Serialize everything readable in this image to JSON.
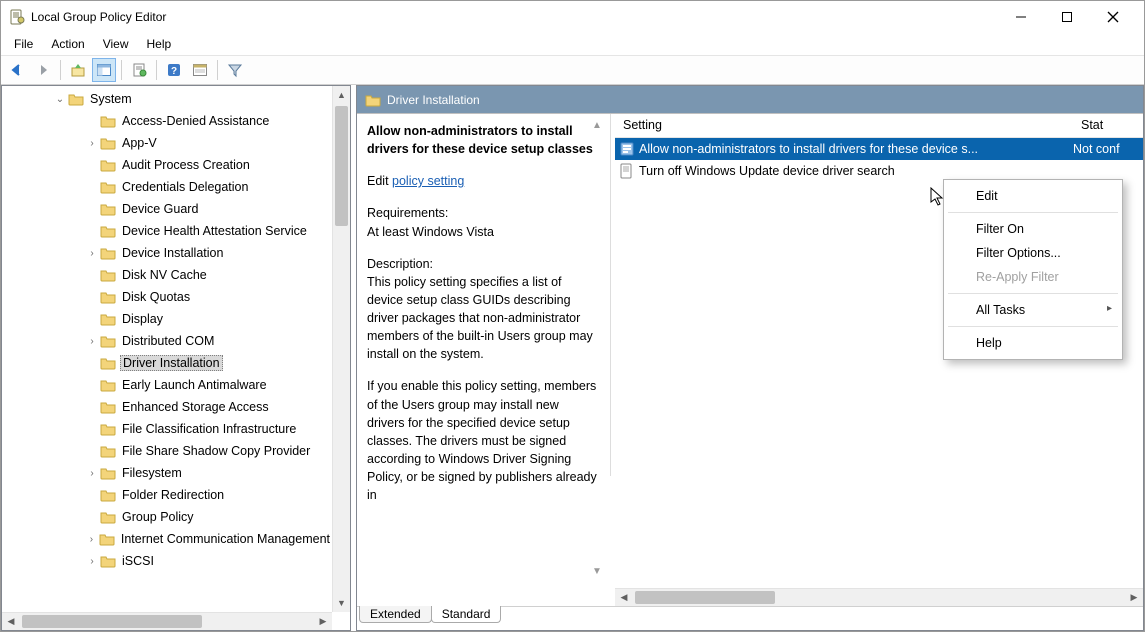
{
  "window": {
    "title": "Local Group Policy Editor"
  },
  "menubar": {
    "items": [
      "File",
      "Action",
      "View",
      "Help"
    ]
  },
  "tree": {
    "root_label": "System",
    "items": [
      {
        "label": "Access-Denied Assistance",
        "expandable": false,
        "indent": 2
      },
      {
        "label": "App-V",
        "expandable": true,
        "indent": 2
      },
      {
        "label": "Audit Process Creation",
        "expandable": false,
        "indent": 2
      },
      {
        "label": "Credentials Delegation",
        "expandable": false,
        "indent": 2
      },
      {
        "label": "Device Guard",
        "expandable": false,
        "indent": 2
      },
      {
        "label": "Device Health Attestation Service",
        "expandable": false,
        "indent": 2
      },
      {
        "label": "Device Installation",
        "expandable": true,
        "indent": 2
      },
      {
        "label": "Disk NV Cache",
        "expandable": false,
        "indent": 2
      },
      {
        "label": "Disk Quotas",
        "expandable": false,
        "indent": 2
      },
      {
        "label": "Display",
        "expandable": false,
        "indent": 2
      },
      {
        "label": "Distributed COM",
        "expandable": true,
        "indent": 2
      },
      {
        "label": "Driver Installation",
        "expandable": false,
        "indent": 2,
        "selected": true
      },
      {
        "label": "Early Launch Antimalware",
        "expandable": false,
        "indent": 2
      },
      {
        "label": "Enhanced Storage Access",
        "expandable": false,
        "indent": 2
      },
      {
        "label": "File Classification Infrastructure",
        "expandable": false,
        "indent": 2
      },
      {
        "label": "File Share Shadow Copy Provider",
        "expandable": false,
        "indent": 2
      },
      {
        "label": "Filesystem",
        "expandable": true,
        "indent": 2
      },
      {
        "label": "Folder Redirection",
        "expandable": false,
        "indent": 2
      },
      {
        "label": "Group Policy",
        "expandable": false,
        "indent": 2
      },
      {
        "label": "Internet Communication Management",
        "expandable": true,
        "indent": 2
      },
      {
        "label": "iSCSI",
        "expandable": true,
        "indent": 2
      }
    ]
  },
  "right": {
    "header_title": "Driver Installation",
    "policy_title": "Allow non-administrators to install drivers for these device setup classes",
    "edit_label": "Edit ",
    "edit_link": "policy setting",
    "req_label": "Requirements:",
    "req_value": "At least Windows Vista",
    "desc_label": "Description:",
    "desc_p1": "This policy setting specifies a list of device setup class GUIDs describing driver packages that non-administrator members of the built-in Users group may install on the system.",
    "desc_p2": "If you enable this policy setting, members of the Users group may install new drivers for the specified device setup classes. The drivers must be signed according to Windows Driver Signing Policy, or be signed by publishers already in",
    "list_header": {
      "setting": "Setting",
      "state": "Stat"
    },
    "list_rows": [
      {
        "text": "Allow non-administrators to install drivers for these device s...",
        "state": "Not conf",
        "selected": true
      },
      {
        "text": "Turn off Windows Update device driver search",
        "state": "",
        "selected": false
      }
    ],
    "tabs": {
      "extended": "Extended",
      "standard": "Standard"
    }
  },
  "context_menu": {
    "items": [
      {
        "label": "Edit",
        "type": "item",
        "highlighted": true
      },
      {
        "type": "sep"
      },
      {
        "label": "Filter On",
        "type": "item"
      },
      {
        "label": "Filter Options...",
        "type": "item"
      },
      {
        "label": "Re-Apply Filter",
        "type": "item",
        "disabled": true
      },
      {
        "type": "sep"
      },
      {
        "label": "All Tasks",
        "type": "item",
        "submenu": true
      },
      {
        "type": "sep"
      },
      {
        "label": "Help",
        "type": "item"
      }
    ]
  }
}
